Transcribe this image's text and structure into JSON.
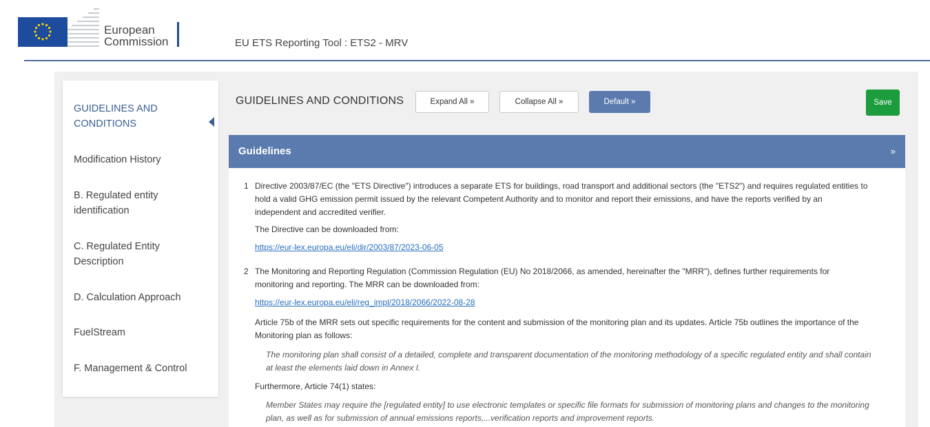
{
  "header": {
    "brand_line1": "European",
    "brand_line2": "Commission",
    "app_title": "EU ETS Reporting Tool : ETS2 - MRV"
  },
  "sidebar": {
    "items": [
      {
        "label": "GUIDELINES AND CONDITIONS",
        "active": true
      },
      {
        "label": "Modification History"
      },
      {
        "label": "B. Regulated entity identification"
      },
      {
        "label": "C. Regulated Entity Description"
      },
      {
        "label": "D. Calculation Approach"
      },
      {
        "label": "FuelStream"
      },
      {
        "label": "F. Management & Control"
      }
    ]
  },
  "toolbar": {
    "section_title": "GUIDELINES AND CONDITIONS",
    "expand_all": "Expand All »",
    "collapse_all": "Collapse All »",
    "default": "Default »",
    "save": "Save"
  },
  "panel": {
    "title": "Guidelines",
    "toggle_icon": "chevrons-down-icon",
    "items": [
      {
        "number": "1",
        "text": "Directive 2003/87/EC (the \"ETS Directive\") introduces a separate ETS for buildings, road transport and additional sectors (the \"ETS2\") and requires regulated entities to hold a valid GHG emission permit issued by the relevant Competent Authority and to monitor and report their emissions, and have the reports verified by an independent and accredited verifier.",
        "download_text": "The Directive can be downloaded from:",
        "link": "https://eur-lex.europa.eu/eli/dir/2003/87/2023-06-05"
      },
      {
        "number": "2",
        "text": "The Monitoring and Reporting Regulation (Commission Regulation (EU) No 2018/2066, as amended, hereinafter the \"MRR\"), defines further requirements for monitoring and reporting. The MRR can be downloaded from:",
        "link": "https://eur-lex.europa.eu/eli/reg_impl/2018/2066/2022-08-28",
        "article_text": "Article 75b of the MRR sets out specific requirements for the content and submission of the monitoring plan and its updates. Article 75b outlines the importance of the Monitoring plan as follows:",
        "quote1": "The monitoring plan shall consist of a detailed, complete and transparent documentation of the monitoring methodology of a specific regulated entity and shall contain at least the elements laid down in Annex I.",
        "furthermore": "Furthermore, Article 74(1) states:",
        "quote2": "Member States may require the [regulated entity] to use electronic templates or specific file formats for submission of monitoring plans and changes to the monitoring plan, as well as for submission of annual emissions reports,...verification reports and improvement reports."
      }
    ]
  },
  "colors": {
    "accent": "#5b7bae",
    "save_green": "#1c9c3d",
    "link": "#2a6fbf",
    "flag_blue": "#1d4b9e"
  }
}
